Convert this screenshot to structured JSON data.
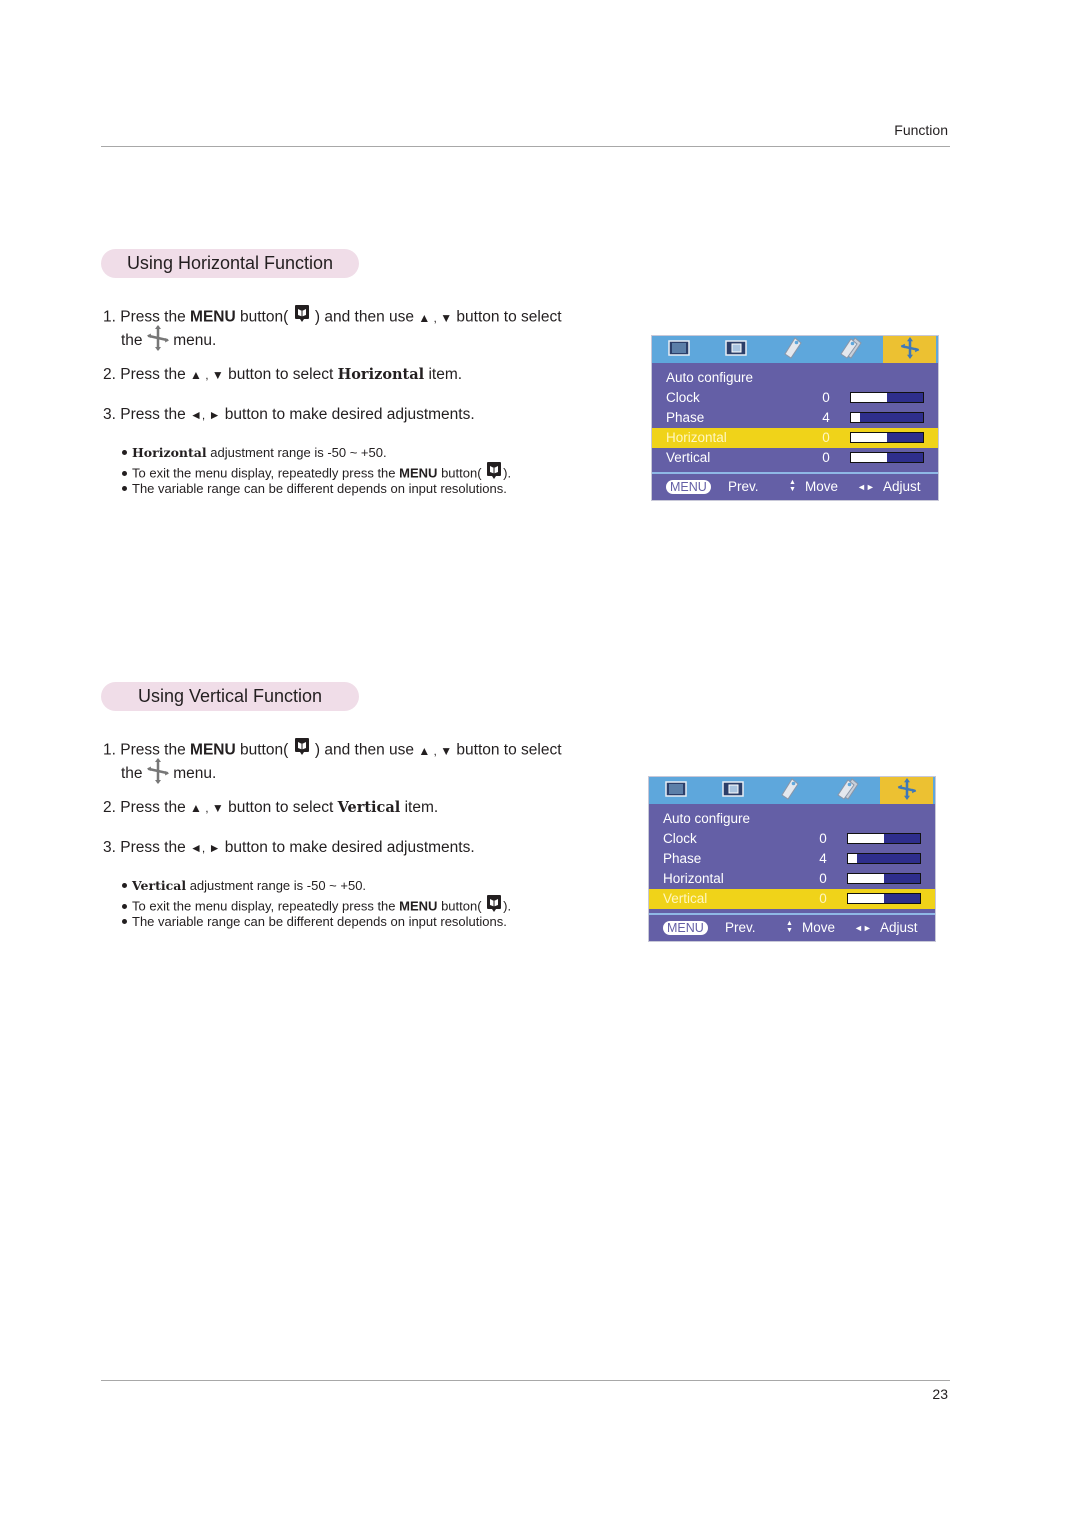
{
  "header": {
    "section_label": "Function"
  },
  "footer": {
    "page_number": "23"
  },
  "sections": [
    {
      "title": "Using Horizontal Function",
      "step1": {
        "num": "1.",
        "pre": "Press the",
        "key": "MENU",
        "mid": "button(",
        "post": ") and then use",
        "arrows": "▲ , ▼",
        "end": "button to select",
        "line2_pre": "the",
        "line2_post": "menu."
      },
      "step2": {
        "num": "2.",
        "pre": "Press the",
        "arrows": "▲ , ▼",
        "mid": "button to select",
        "item": "Horizontal",
        "end": "item."
      },
      "step3": {
        "num": "3.",
        "pre": "Press the",
        "arrows": "◄, ►",
        "end": "button to make desired adjustments."
      },
      "notes": {
        "range_item": "Horizontal",
        "range_text": "adjustment range is -50 ~ +50.",
        "exit_pre": "To exit the menu display, repeatedly press the",
        "exit_key": "MENU",
        "exit_mid": "button(",
        "exit_end": ").",
        "variable": "The variable range can be different depends on input resolutions."
      },
      "osd": {
        "tabs": [
          "picture-icon",
          "screen-icon",
          "tag-icon",
          "tags-icon",
          "move-cross-icon"
        ],
        "active_tab": 4,
        "rows": [
          {
            "label": "Auto configure",
            "value": "",
            "fill": null
          },
          {
            "label": "Clock",
            "value": "0",
            "fill": 0.5
          },
          {
            "label": "Phase",
            "value": "4",
            "fill": 0.13
          },
          {
            "label": "Horizontal",
            "value": "0",
            "fill": 0.5
          },
          {
            "label": "Vertical",
            "value": "0",
            "fill": 0.5
          }
        ],
        "selected_row": 3,
        "footer": {
          "menu_key": "MENU",
          "prev": "Prev.",
          "move_arrows": "▲▼",
          "move": "Move",
          "adjust_arrows": "◄►",
          "adjust": "Adjust"
        }
      }
    },
    {
      "title": "Using Vertical Function",
      "step1": {
        "num": "1.",
        "pre": "Press the",
        "key": "MENU",
        "mid": "button(",
        "post": ") and then use",
        "arrows": "▲ , ▼",
        "end": "button to select",
        "line2_pre": "the",
        "line2_post": "menu."
      },
      "step2": {
        "num": "2.",
        "pre": "Press the",
        "arrows": "▲ , ▼",
        "mid": "button to select",
        "item": "Vertical",
        "end": "item."
      },
      "step3": {
        "num": "3.",
        "pre": "Press the",
        "arrows": "◄, ►",
        "end": "button to make desired adjustments."
      },
      "notes": {
        "range_item": "Vertical",
        "range_text": "adjustment range is -50 ~ +50.",
        "exit_pre": "To exit the menu display, repeatedly press the",
        "exit_key": "MENU",
        "exit_mid": "button(",
        "exit_end": ").",
        "variable": "The variable range can be different depends on input resolutions."
      },
      "osd": {
        "tabs": [
          "picture-icon",
          "screen-icon",
          "tag-icon",
          "tags-icon",
          "move-cross-icon"
        ],
        "active_tab": 4,
        "rows": [
          {
            "label": "Auto configure",
            "value": "",
            "fill": null
          },
          {
            "label": "Clock",
            "value": "0",
            "fill": 0.5
          },
          {
            "label": "Phase",
            "value": "4",
            "fill": 0.13
          },
          {
            "label": "Horizontal",
            "value": "0",
            "fill": 0.5
          },
          {
            "label": "Vertical",
            "value": "0",
            "fill": 0.5
          }
        ],
        "selected_row": 4,
        "footer": {
          "menu_key": "MENU",
          "prev": "Prev.",
          "move_arrows": "▲▼",
          "move": "Move",
          "adjust_arrows": "◄►",
          "adjust": "Adjust"
        }
      }
    }
  ],
  "colors": {
    "pill": "#f0dde8",
    "osd_bg": "#645fa6",
    "osd_tabs": "#5ea7dc",
    "osd_active_tab": "#ecc132",
    "osd_selected": "#f0d319",
    "bar_bg": "#2e2e8c"
  }
}
